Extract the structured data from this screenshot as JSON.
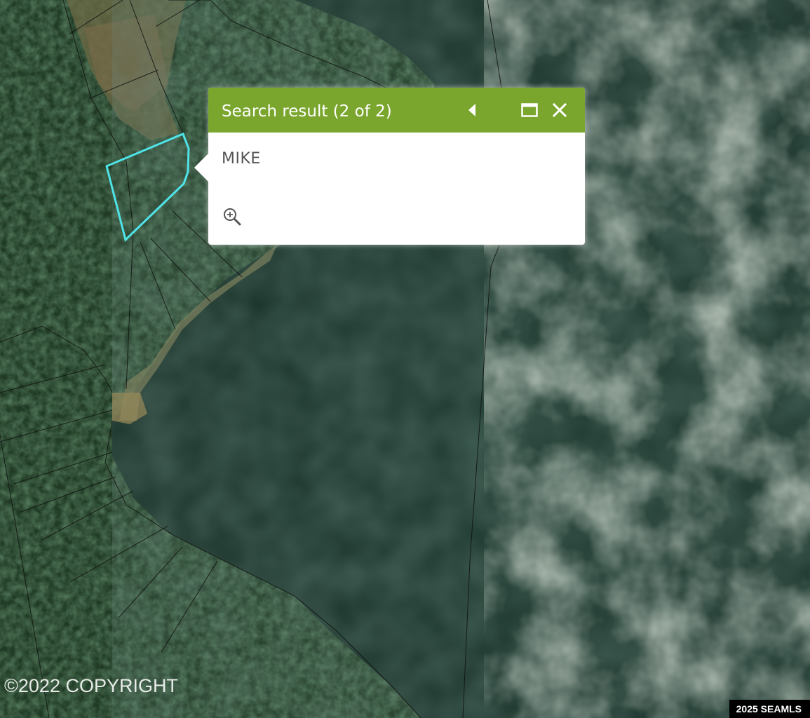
{
  "map": {
    "base_layer": "satellite imagery",
    "highlight_color": "#4fe3e8",
    "parcel_line_color": "#111111"
  },
  "popup": {
    "title": "Search result (2 of 2)",
    "content": "MIKE",
    "header_color": "#7aa62e",
    "prev_icon": "triangle-left-icon",
    "maximize_icon": "maximize-icon",
    "close_icon": "close-icon",
    "zoom_icon": "zoom-in-icon"
  },
  "copyright": "©2022 COPYRIGHT",
  "attribution": "2025 SEAMLS"
}
